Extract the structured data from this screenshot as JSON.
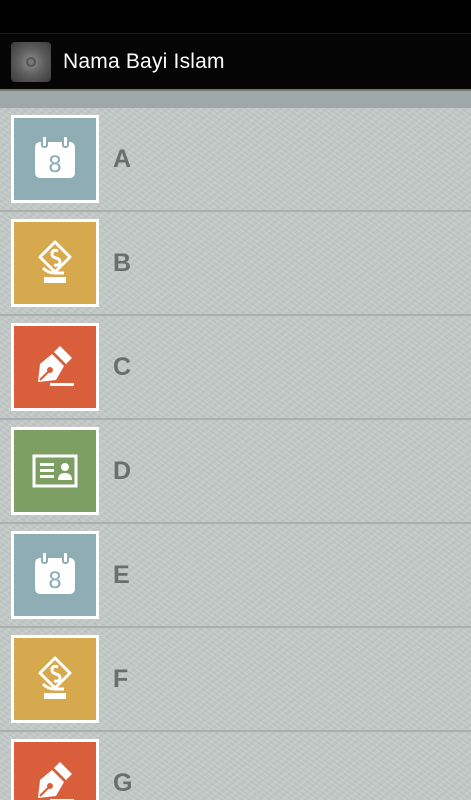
{
  "app": {
    "title": "Nama Bayi Islam"
  },
  "colors": {
    "blue_tile": "#8fadb4",
    "yellow_tile": "#d7a94f",
    "orange_tile": "#d95f3c",
    "green_tile": "#7e9f63"
  },
  "list": [
    {
      "letter": "A",
      "icon": "calendar-icon",
      "color": "blue"
    },
    {
      "letter": "B",
      "icon": "hand-money-icon",
      "color": "yellow"
    },
    {
      "letter": "C",
      "icon": "pen-nib-icon",
      "color": "orange"
    },
    {
      "letter": "D",
      "icon": "id-card-icon",
      "color": "green"
    },
    {
      "letter": "E",
      "icon": "calendar-icon",
      "color": "blue"
    },
    {
      "letter": "F",
      "icon": "hand-money-icon",
      "color": "yellow"
    },
    {
      "letter": "G",
      "icon": "pen-nib-icon",
      "color": "orange"
    }
  ],
  "calendar_day": "8"
}
